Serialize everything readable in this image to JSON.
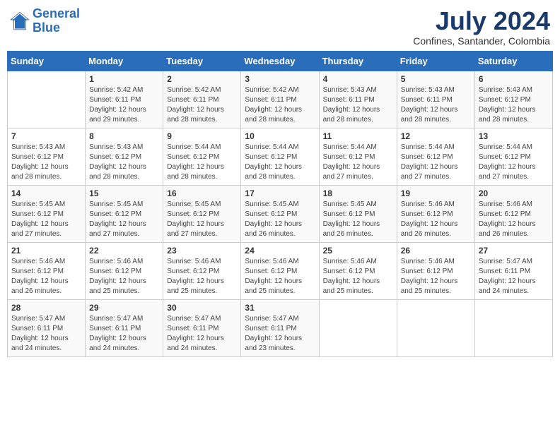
{
  "header": {
    "logo_line1": "General",
    "logo_line2": "Blue",
    "month_year": "July 2024",
    "location": "Confines, Santander, Colombia"
  },
  "weekdays": [
    "Sunday",
    "Monday",
    "Tuesday",
    "Wednesday",
    "Thursday",
    "Friday",
    "Saturday"
  ],
  "weeks": [
    [
      {
        "day": "",
        "info": ""
      },
      {
        "day": "1",
        "info": "Sunrise: 5:42 AM\nSunset: 6:11 PM\nDaylight: 12 hours\nand 29 minutes."
      },
      {
        "day": "2",
        "info": "Sunrise: 5:42 AM\nSunset: 6:11 PM\nDaylight: 12 hours\nand 28 minutes."
      },
      {
        "day": "3",
        "info": "Sunrise: 5:42 AM\nSunset: 6:11 PM\nDaylight: 12 hours\nand 28 minutes."
      },
      {
        "day": "4",
        "info": "Sunrise: 5:43 AM\nSunset: 6:11 PM\nDaylight: 12 hours\nand 28 minutes."
      },
      {
        "day": "5",
        "info": "Sunrise: 5:43 AM\nSunset: 6:11 PM\nDaylight: 12 hours\nand 28 minutes."
      },
      {
        "day": "6",
        "info": "Sunrise: 5:43 AM\nSunset: 6:12 PM\nDaylight: 12 hours\nand 28 minutes."
      }
    ],
    [
      {
        "day": "7",
        "info": "Sunrise: 5:43 AM\nSunset: 6:12 PM\nDaylight: 12 hours\nand 28 minutes."
      },
      {
        "day": "8",
        "info": "Sunrise: 5:43 AM\nSunset: 6:12 PM\nDaylight: 12 hours\nand 28 minutes."
      },
      {
        "day": "9",
        "info": "Sunrise: 5:44 AM\nSunset: 6:12 PM\nDaylight: 12 hours\nand 28 minutes."
      },
      {
        "day": "10",
        "info": "Sunrise: 5:44 AM\nSunset: 6:12 PM\nDaylight: 12 hours\nand 28 minutes."
      },
      {
        "day": "11",
        "info": "Sunrise: 5:44 AM\nSunset: 6:12 PM\nDaylight: 12 hours\nand 27 minutes."
      },
      {
        "day": "12",
        "info": "Sunrise: 5:44 AM\nSunset: 6:12 PM\nDaylight: 12 hours\nand 27 minutes."
      },
      {
        "day": "13",
        "info": "Sunrise: 5:44 AM\nSunset: 6:12 PM\nDaylight: 12 hours\nand 27 minutes."
      }
    ],
    [
      {
        "day": "14",
        "info": "Sunrise: 5:45 AM\nSunset: 6:12 PM\nDaylight: 12 hours\nand 27 minutes."
      },
      {
        "day": "15",
        "info": "Sunrise: 5:45 AM\nSunset: 6:12 PM\nDaylight: 12 hours\nand 27 minutes."
      },
      {
        "day": "16",
        "info": "Sunrise: 5:45 AM\nSunset: 6:12 PM\nDaylight: 12 hours\nand 27 minutes."
      },
      {
        "day": "17",
        "info": "Sunrise: 5:45 AM\nSunset: 6:12 PM\nDaylight: 12 hours\nand 26 minutes."
      },
      {
        "day": "18",
        "info": "Sunrise: 5:45 AM\nSunset: 6:12 PM\nDaylight: 12 hours\nand 26 minutes."
      },
      {
        "day": "19",
        "info": "Sunrise: 5:46 AM\nSunset: 6:12 PM\nDaylight: 12 hours\nand 26 minutes."
      },
      {
        "day": "20",
        "info": "Sunrise: 5:46 AM\nSunset: 6:12 PM\nDaylight: 12 hours\nand 26 minutes."
      }
    ],
    [
      {
        "day": "21",
        "info": "Sunrise: 5:46 AM\nSunset: 6:12 PM\nDaylight: 12 hours\nand 26 minutes."
      },
      {
        "day": "22",
        "info": "Sunrise: 5:46 AM\nSunset: 6:12 PM\nDaylight: 12 hours\nand 25 minutes."
      },
      {
        "day": "23",
        "info": "Sunrise: 5:46 AM\nSunset: 6:12 PM\nDaylight: 12 hours\nand 25 minutes."
      },
      {
        "day": "24",
        "info": "Sunrise: 5:46 AM\nSunset: 6:12 PM\nDaylight: 12 hours\nand 25 minutes."
      },
      {
        "day": "25",
        "info": "Sunrise: 5:46 AM\nSunset: 6:12 PM\nDaylight: 12 hours\nand 25 minutes."
      },
      {
        "day": "26",
        "info": "Sunrise: 5:46 AM\nSunset: 6:12 PM\nDaylight: 12 hours\nand 25 minutes."
      },
      {
        "day": "27",
        "info": "Sunrise: 5:47 AM\nSunset: 6:11 PM\nDaylight: 12 hours\nand 24 minutes."
      }
    ],
    [
      {
        "day": "28",
        "info": "Sunrise: 5:47 AM\nSunset: 6:11 PM\nDaylight: 12 hours\nand 24 minutes."
      },
      {
        "day": "29",
        "info": "Sunrise: 5:47 AM\nSunset: 6:11 PM\nDaylight: 12 hours\nand 24 minutes."
      },
      {
        "day": "30",
        "info": "Sunrise: 5:47 AM\nSunset: 6:11 PM\nDaylight: 12 hours\nand 24 minutes."
      },
      {
        "day": "31",
        "info": "Sunrise: 5:47 AM\nSunset: 6:11 PM\nDaylight: 12 hours\nand 23 minutes."
      },
      {
        "day": "",
        "info": ""
      },
      {
        "day": "",
        "info": ""
      },
      {
        "day": "",
        "info": ""
      }
    ]
  ]
}
